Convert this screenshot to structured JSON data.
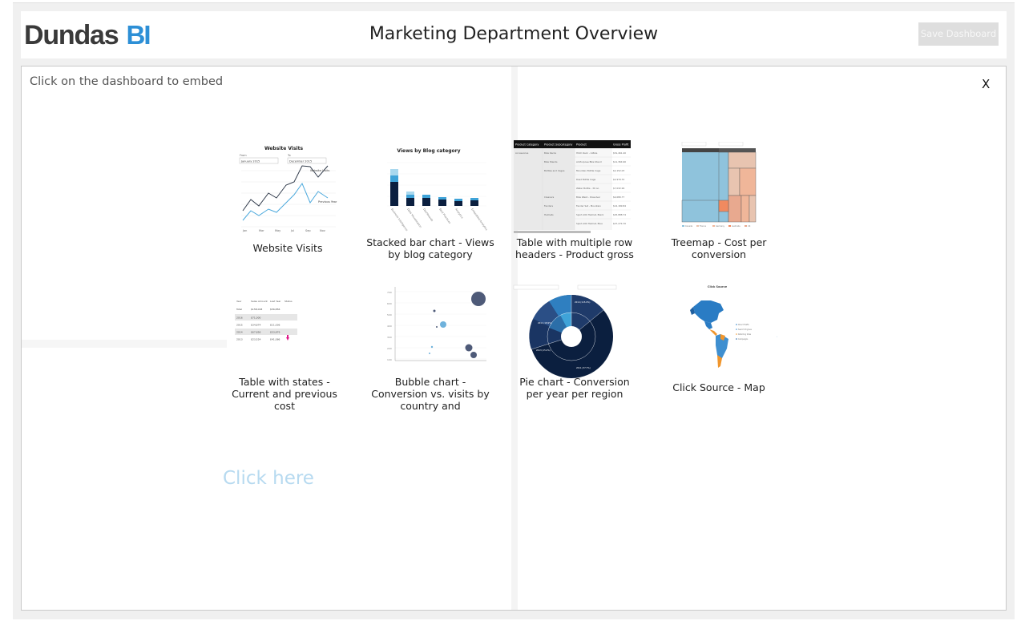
{
  "header": {
    "logo_main": "Dundas",
    "logo_bi": "BI",
    "title": "Marketing Department Overview",
    "save_label": "Save Dashboard"
  },
  "panel": {
    "hint": "Click on the dashboard to embed",
    "close_label": "X",
    "click_here": "Click here"
  },
  "tiles": [
    {
      "label": "Website Visits",
      "thumb": {
        "title": "Website Visits",
        "from_label": "From",
        "from_value": "January 2015",
        "to_label": "To",
        "to_value": "December 2015",
        "series": [
          "Website Visits",
          "Previous Year"
        ]
      }
    },
    {
      "label": "Stacked bar chart - Views by blog category",
      "thumb": {
        "title": "Views by Blog category"
      }
    },
    {
      "label": "Table with multiple row headers - Product gross",
      "thumb": {
        "headers": [
          "Product Category",
          "Product Subcategory",
          "Product",
          "Gross Profit"
        ]
      }
    },
    {
      "label": "Treemap - Cost per conversion"
    },
    {
      "label": "Table with states - Current and previous cost",
      "thumb": {
        "headers": [
          "Year",
          "Sales Amount",
          "Last Year",
          "Status"
        ],
        "rows": [
          [
            "Total",
            "$158,018",
            "$56,856"
          ],
          [
            "2016",
            "$71,000",
            ""
          ],
          [
            "2015",
            "$34,874",
            "$11,036"
          ],
          [
            "2014",
            "$67,856",
            "$53,879"
          ],
          [
            "2013",
            "$23,524",
            "$41,086"
          ]
        ]
      }
    },
    {
      "label": "Bubble chart - Conversion vs. visits by country and"
    },
    {
      "label": "Pie chart - Conversion per year per region"
    },
    {
      "label": "Click Source - Map",
      "thumb": {
        "title": "Click Source"
      }
    }
  ],
  "colors": {
    "accent": "#2d8fd6",
    "navy": "#0b1f3f",
    "teal": "#5aa9d6"
  }
}
